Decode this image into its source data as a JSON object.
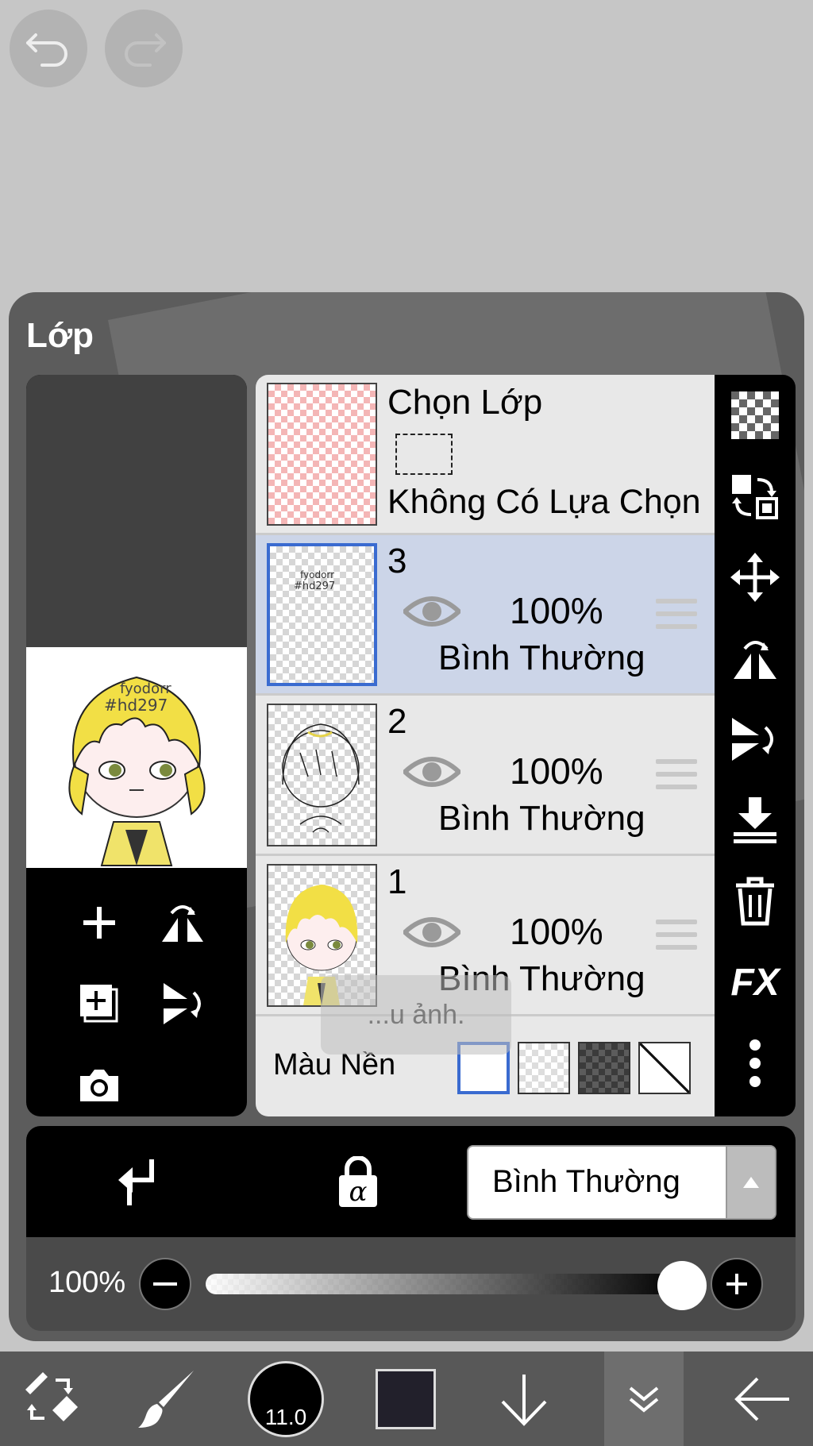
{
  "panel": {
    "title": "Lớp"
  },
  "selection_layer": {
    "title": "Chọn Lớp",
    "status": "Không Có Lựa Chọn"
  },
  "layers": [
    {
      "number": "3",
      "opacity": "100%",
      "blend_mode": "Bình Thường",
      "selected": true
    },
    {
      "number": "2",
      "opacity": "100%",
      "blend_mode": "Bình Thường",
      "selected": false
    },
    {
      "number": "1",
      "opacity": "100%",
      "blend_mode": "Bình Thường",
      "selected": false
    }
  ],
  "background": {
    "label": "Màu Nền",
    "options": [
      "white",
      "transparent-light",
      "transparent-dark",
      "none"
    ],
    "selected": "white"
  },
  "toast": {
    "text": "...u ảnh."
  },
  "action_bar": {
    "blend_mode": "Bình Thường"
  },
  "opacity_slider": {
    "label": "100%",
    "value": 1.0
  },
  "bottom_toolbar": {
    "brush_size": "11.0",
    "current_color": "#22202b"
  },
  "colors": {
    "accent": "#3a6bd0",
    "selected_row": "#ccd5e8"
  },
  "icons": {
    "top": [
      "undo-icon",
      "redo-icon"
    ],
    "preview_tools": [
      "add-layer-icon",
      "flip-horizontal-icon",
      "add-layer-copy-icon",
      "flip-vertical-icon",
      "camera-icon"
    ],
    "right_bar": [
      "transparency-icon",
      "swap-layers-icon",
      "move-icon",
      "flip-horizontal-icon",
      "flip-vertical-icon",
      "merge-down-icon",
      "trash-icon",
      "fx-icon",
      "more-icon"
    ],
    "action_bar": [
      "clip-icon",
      "alpha-lock-icon"
    ],
    "bottom": [
      "transform-eraser-icon",
      "brush-icon",
      "brush-size-icon",
      "color-icon",
      "arrow-down-icon",
      "double-chevron-down-icon",
      "back-arrow-icon"
    ]
  },
  "right_bar_fx_label": "FX"
}
